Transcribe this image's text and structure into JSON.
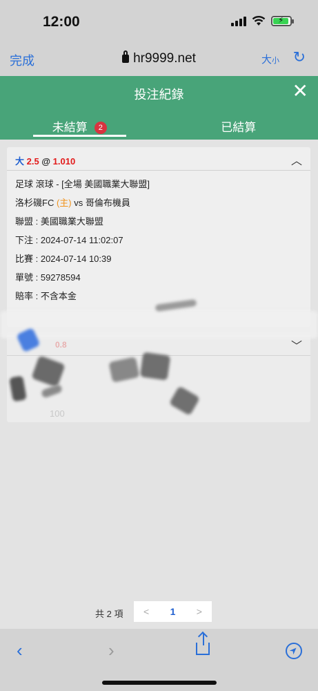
{
  "status": {
    "time": "12:00"
  },
  "browser": {
    "done": "完成",
    "url": "hr9999.net",
    "text_size_big": "大",
    "text_size_small": "小"
  },
  "header": {
    "title": "投注紀錄"
  },
  "tabs": [
    {
      "label": "未結算",
      "badge": "2"
    },
    {
      "label": "已結算"
    }
  ],
  "bets": [
    {
      "pick": "大",
      "line": "2.5",
      "at": "@",
      "odds": "1.010",
      "sport": "足球 滾球 - [全場 美國職業大聯盟]",
      "home": "洛杉磯FC",
      "home_tag": "(主)",
      "vs": "vs",
      "away": "哥倫布機員",
      "league": "聯盟 : 美國職業大聯盟",
      "bet_time": "下注 : 2024-07-14 11:02:07",
      "match_time": "比賽 : 2024-07-14 10:39",
      "ticket": "單號 : 59278594",
      "odds_type": "賠率 : 不含本金"
    },
    {
      "odds_fragment": "0.8",
      "amount_fragment": "100"
    }
  ],
  "pager": {
    "total": "共 2 項",
    "prev": "<",
    "page": "1",
    "next": ">"
  },
  "colors": {
    "header_green": "#48a479",
    "link_blue": "#2a6fd8",
    "odds_red": "#e21b1b",
    "badge_red": "#d8333f"
  }
}
